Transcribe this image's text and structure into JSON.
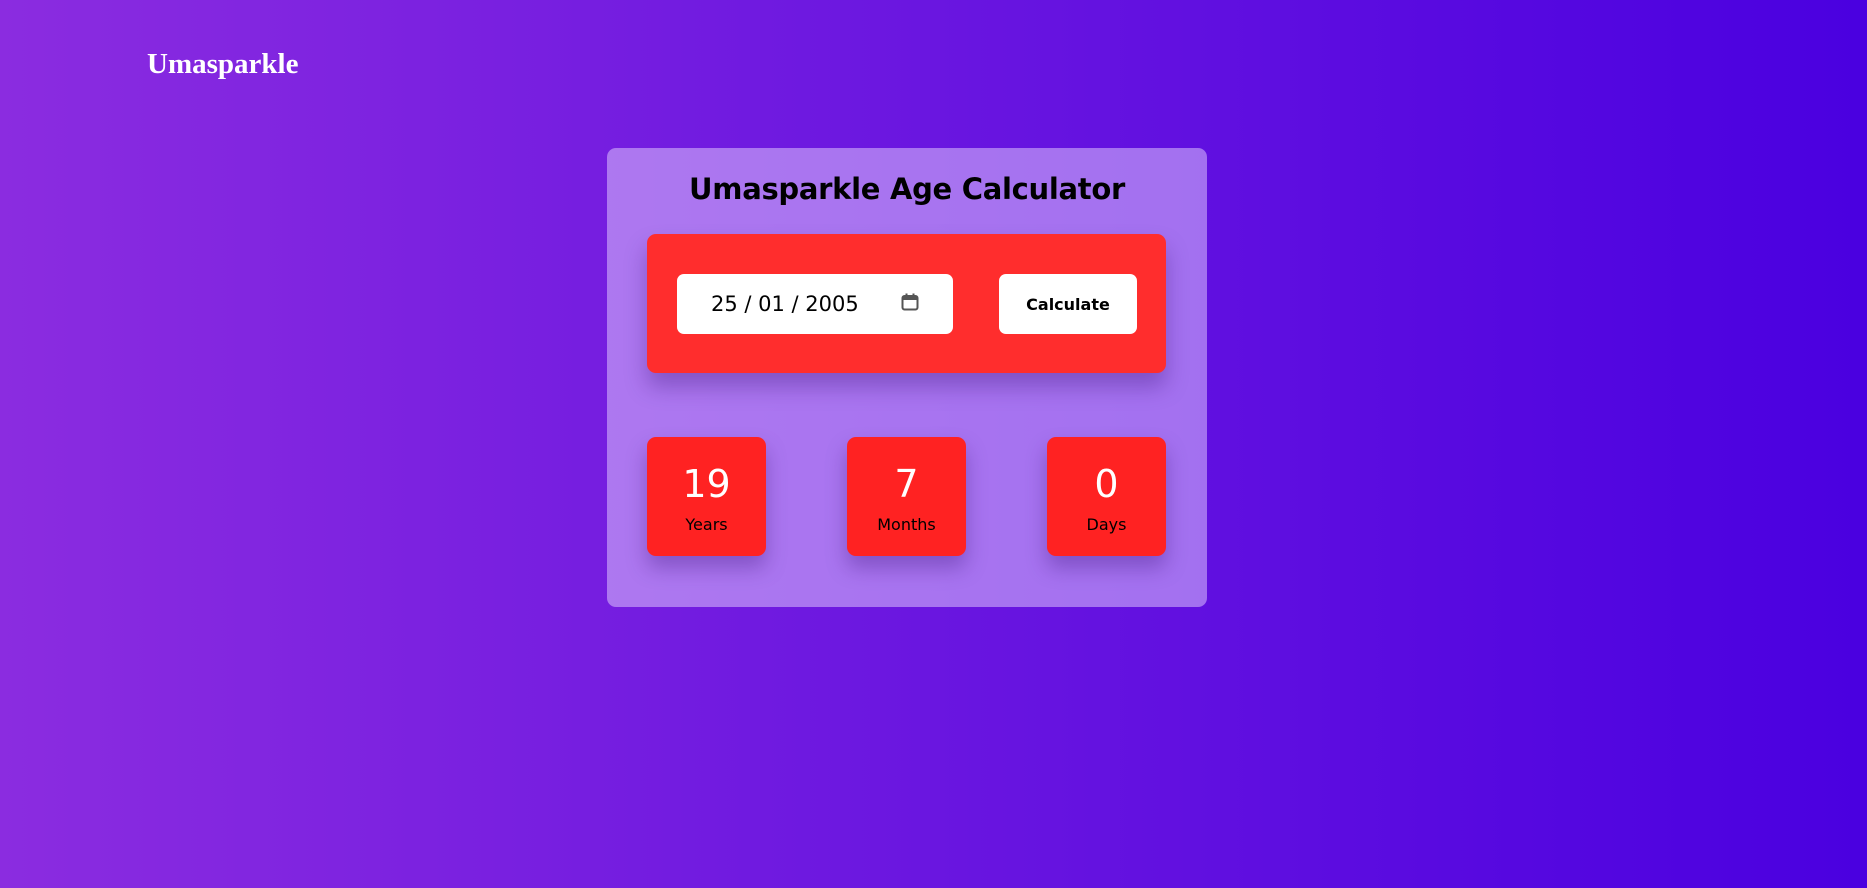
{
  "header": {
    "logo": "Umasparkle"
  },
  "calculator": {
    "title": "Umasparkle Age Calculator",
    "date_value": "25 / 01 / 2005",
    "calendar_icon": "calendar-icon",
    "calculate_label": "Calculate",
    "results": [
      {
        "value": "19",
        "label": "Years"
      },
      {
        "value": "7",
        "label": "Months"
      },
      {
        "value": "0",
        "label": "Days"
      }
    ]
  },
  "colors": {
    "panel": "#ff2d2d",
    "result_box": "#ff2222",
    "bg_start": "#8b2ce0",
    "bg_end": "#4a00e0"
  }
}
